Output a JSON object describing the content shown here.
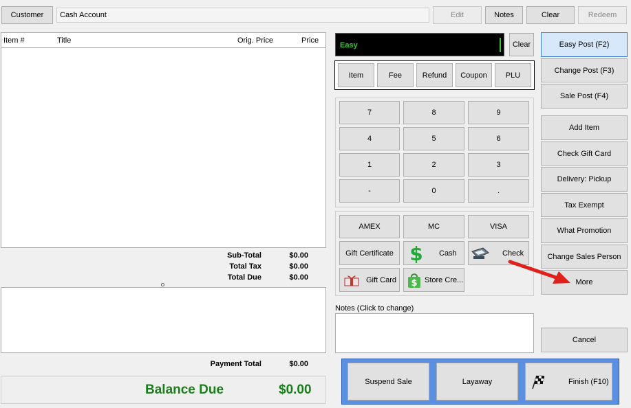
{
  "top": {
    "customer_button": "Customer",
    "customer_value": "Cash Account",
    "edit": "Edit",
    "notes": "Notes",
    "clear": "Clear",
    "redeem": "Redeem"
  },
  "items_table": {
    "columns": [
      "Item #",
      "Title",
      "Orig. Price",
      "Price"
    ],
    "rows": []
  },
  "totals": {
    "subtotal_label": "Sub-Total",
    "subtotal": "$0.00",
    "tax_label": "Total Tax",
    "tax": "$0.00",
    "due_label": "Total Due",
    "due": "$0.00",
    "payment_label": "Payment Total",
    "payment": "$0.00",
    "balance_label": "Balance Due",
    "balance": "$0.00"
  },
  "entry": {
    "value": "Easy",
    "clear": "Clear"
  },
  "modes": [
    "Item",
    "Fee",
    "Refund",
    "Coupon",
    "PLU"
  ],
  "keypad": [
    "7",
    "8",
    "9",
    "4",
    "5",
    "6",
    "1",
    "2",
    "3",
    "-",
    "0",
    "."
  ],
  "tenders": {
    "amex": "AMEX",
    "mc": "MC",
    "visa": "VISA",
    "gift_certificate": "Gift Certificate",
    "cash": "Cash",
    "check": "Check",
    "gift_card": "Gift Card",
    "store_credit": "Store Cre..."
  },
  "notes_label": "Notes (Click to change)",
  "side_buttons": {
    "easy_post": "Easy Post (F2)",
    "change_post": "Change Post (F3)",
    "sale_post": "Sale Post (F4)",
    "add_item": "Add Item",
    "check_gift_card": "Check Gift Card",
    "delivery": "Delivery: Pickup",
    "tax_exempt": "Tax Exempt",
    "what_promotion": "What Promotion",
    "change_sales_person": "Change Sales Person",
    "more": "More",
    "cancel": "Cancel"
  },
  "bottom": {
    "suspend": "Suspend Sale",
    "layaway": "Layaway",
    "finish": "Finish (F10)"
  },
  "colors": {
    "balance_green": "#1a7f1a",
    "entry_text": "#35c535",
    "bottom_panel": "#5b8fe0",
    "arrow_red": "#e0201b",
    "selected_blue": "#d6e8fa"
  }
}
